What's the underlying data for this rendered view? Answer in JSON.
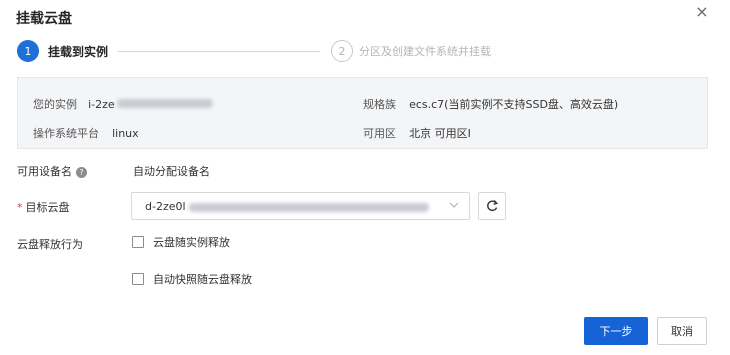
{
  "dialog": {
    "title": "挂载云盘",
    "close_glyph": "×"
  },
  "steps": [
    {
      "number": "1",
      "label": "挂载到实例",
      "active": true
    },
    {
      "number": "2",
      "label": "分区及创建文件系统并挂载",
      "active": false
    }
  ],
  "info": {
    "instance_label": "您的实例",
    "instance_value": "i-2ze",
    "spec_label": "规格族",
    "spec_value": "ecs.c7(当前实例不支持SSD盘、高效云盘)",
    "os_label": "操作系统平台",
    "os_value": "linux",
    "zone_label": "可用区",
    "zone_value": "北京 可用区I"
  },
  "form": {
    "device_label": "可用设备名",
    "device_value": "自动分配设备名",
    "target_label": "目标云盘",
    "target_value": "d-2ze0l",
    "release_label": "云盘释放行为",
    "release_options": [
      {
        "label": "云盘随实例释放",
        "checked": false
      },
      {
        "label": "自动快照随云盘释放",
        "checked": false
      }
    ]
  },
  "footer": {
    "next_label": "下一步",
    "cancel_label": "取消"
  },
  "colors": {
    "primary": "#1563d6",
    "required": "#e43a3a",
    "panel_bg": "#f4f5f7"
  }
}
